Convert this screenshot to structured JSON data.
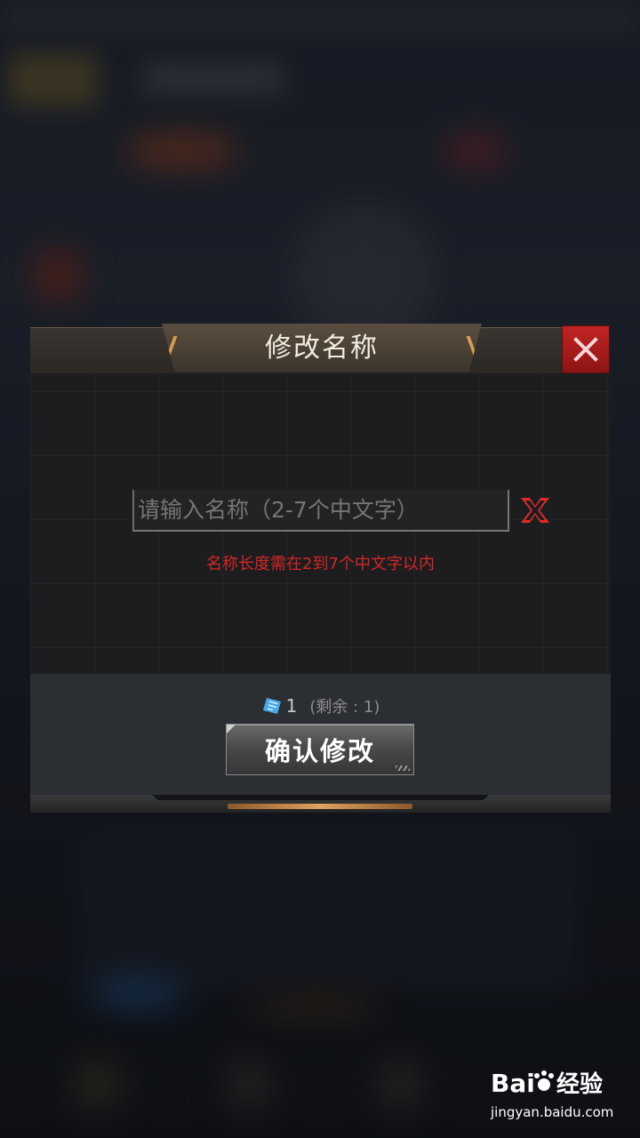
{
  "dialog": {
    "title": "修改名称",
    "input": {
      "value": "",
      "placeholder": "请输入名称（2-7个中文字）"
    },
    "error_message": "名称长度需在2到7个中文字以内",
    "cost": {
      "amount": "1",
      "remaining": "(剩余 : 1)"
    },
    "confirm_label": "确认修改"
  },
  "icons": {
    "close": "close-icon",
    "clear": "clear-input-icon",
    "ticket": "rename-card-icon"
  },
  "colors": {
    "close_button": "#b01c1c",
    "clear_icon": "#e02a2a",
    "error_text": "#d32626",
    "title_accent": "#d69a55",
    "ticket": "#4aa8e8"
  },
  "watermark": {
    "logo_text": "Bai  经验",
    "url": "jingyan.baidu.com"
  }
}
